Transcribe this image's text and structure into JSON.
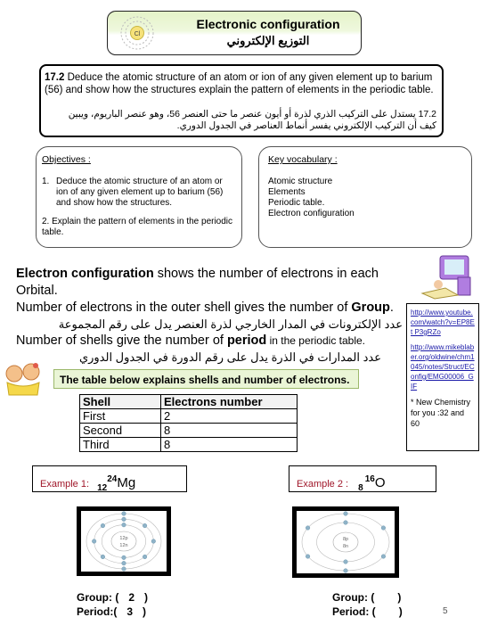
{
  "header": {
    "title": "Electronic configuration",
    "title_ar": "التوزيع الإلكتروني",
    "atom_symbol": "Cl"
  },
  "standard": {
    "code": "17.2",
    "text": "Deduce the atomic structure of an atom or ion of any given element up to barium (56) and show how the structures explain the pattern of elements in the periodic table.",
    "text_ar": "17.2 يستدل على التركيب الذري لذرة أو أيون عنصر ما حتى العنصر 56، وهو عنصر الباريوم، ويبين كيف أن التركيب الإلكتروني يفسر أنماط العناصر في الجدول الدوري."
  },
  "objectives": {
    "heading": "Objectives :",
    "items": [
      {
        "num": "1.",
        "text": "Deduce the atomic structure of an atom or ion of any given element up to barium (56) and show how the structures."
      },
      {
        "num": "2.",
        "text": "Explain the pattern of elements in the periodic table."
      }
    ]
  },
  "vocabulary": {
    "heading": "Key vocabulary :",
    "items": [
      "Atomic structure",
      "Elements",
      "Periodic table.",
      "Electron configuration"
    ]
  },
  "main": {
    "line1_bold": "Electron configuration",
    "line1_rest": " shows the number of electrons in each Orbital.",
    "line2_pre": "Number of electrons in the outer shell gives the number of ",
    "line2_bold": "Group",
    "line2_post": ".",
    "line2_ar": "عدد الإلكترونات في المدار الخارجي لذرة العنصر يدل على رقم المجموعة",
    "line3_pre": "Number of  shells give the number of ",
    "line3_bold": "period",
    "line3_post": "  in the periodic table.",
    "line3_ar": "عدد المدارات في الذرة يدل على رقم الدورة في الجدول الدوري"
  },
  "callout": "The table below explains shells and number of electrons.",
  "shell_table": {
    "headers": [
      "Shell",
      "Electrons number"
    ],
    "rows": [
      [
        "First",
        "2"
      ],
      [
        "Second",
        "8"
      ],
      [
        "Third",
        "8"
      ]
    ]
  },
  "links": {
    "items": [
      "http://www.youtube.com/watch?v=EP8Et P3gRZo",
      "http://www.mikeblaber.org/oldwine/chm1045/notes/Struct/EConfig/EMG00006_G IF"
    ],
    "note": "* New Chemistry for you :32 and 60"
  },
  "examples": [
    {
      "label": "Example 1:",
      "atomic_number": "12",
      "mass_number": "24",
      "symbol": "Mg",
      "nucleus": [
        "12p",
        "12n"
      ],
      "shells": [
        2,
        8,
        2
      ],
      "group_label": "Group:",
      "group_value": "2",
      "period_label": "Period:",
      "period_value": "3"
    },
    {
      "label": "Example 2 :",
      "atomic_number": "8",
      "mass_number": "16",
      "symbol": "O",
      "nucleus": [
        "8p",
        "8n"
      ],
      "shells": [
        2,
        6
      ],
      "group_label": "Group:",
      "group_value": "",
      "period_label": "Period:",
      "period_value": ""
    }
  ],
  "page_number": "5"
}
